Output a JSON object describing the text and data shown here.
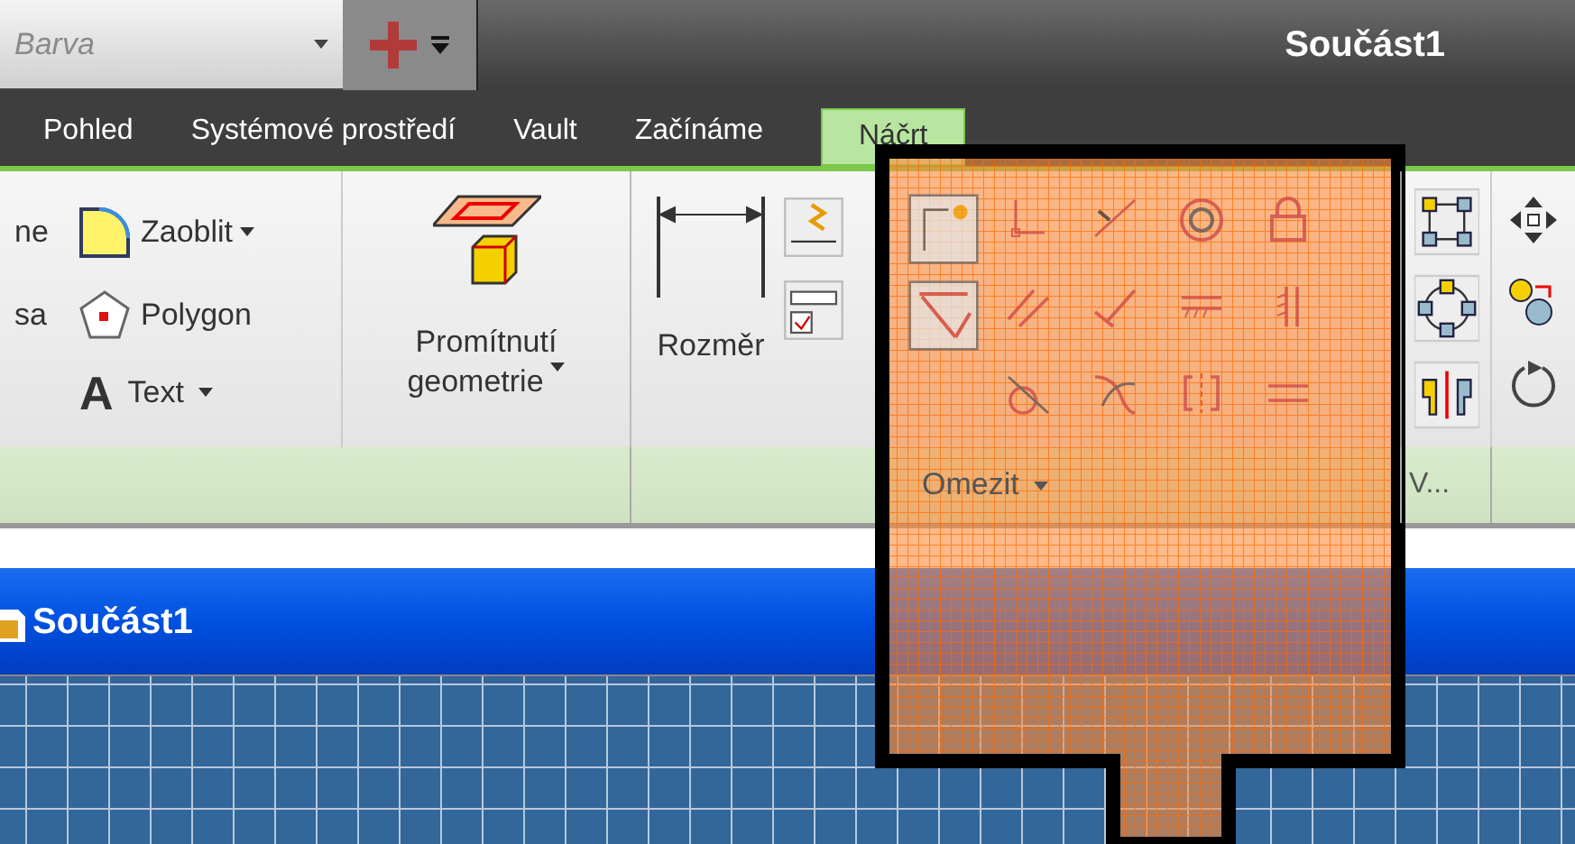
{
  "quick_access": {
    "style_value": "Barva"
  },
  "title": "Součást1",
  "tabs": [
    {
      "label": "Pohled",
      "selected": false
    },
    {
      "label": "Systémové prostředí",
      "selected": false
    },
    {
      "label": "Vault",
      "selected": false
    },
    {
      "label": "Začínáme",
      "selected": false
    },
    {
      "label": "Náčrt",
      "selected": true
    }
  ],
  "ribbon": {
    "draw_rows": [
      {
        "cut_label": "ne",
        "label": "Zaoblit",
        "dropdown": true
      },
      {
        "cut_label": "sa",
        "label": "Polygon",
        "dropdown": false
      }
    ],
    "text_button": {
      "glyph": "A",
      "label": "Text"
    },
    "project_button": {
      "label_lines": [
        "Promítnutí",
        "geometrie"
      ]
    },
    "dimension_button": {
      "label": "Rozměr"
    },
    "panel_labels": [
      {
        "label": "Omezit"
      },
      {
        "label": "V..."
      }
    ]
  },
  "document": {
    "title": "Součást1"
  }
}
